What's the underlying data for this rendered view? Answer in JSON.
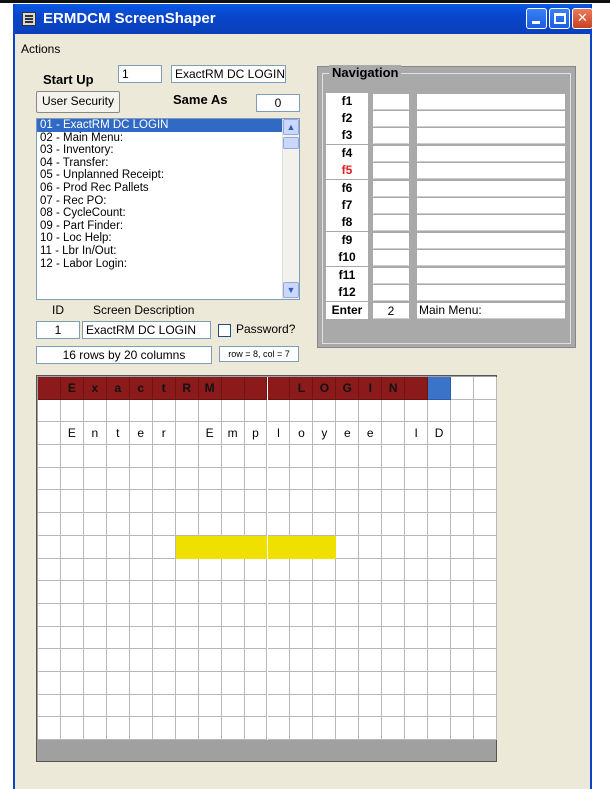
{
  "window": {
    "title": "ERMDCM ScreenShaper"
  },
  "menu": {
    "actions": "Actions"
  },
  "startup": {
    "label": "Start Up",
    "id_value": "1",
    "name_value": "ExactRM DC  LOGIN",
    "user_security": "User Security",
    "same_as_label": "Same As",
    "same_as_value": "0"
  },
  "screens": [
    "01 - ExactRM DC  LOGIN",
    "02 - Main Menu:",
    "03 - Inventory:",
    "04 - Transfer:",
    "05 - Unplanned Receipt:",
    "06 - Prod Rec Pallets",
    "07 - Rec PO:",
    "08 - CycleCount:",
    "09 - Part Finder:",
    "10 - Loc Help:",
    "11 - Lbr In/Out:",
    "12 - Labor Login:"
  ],
  "detail": {
    "id_label": "ID",
    "desc_label": "Screen Description",
    "id_value": "1",
    "desc_value": "ExactRM DC  LOGIN",
    "password_label": "Password?",
    "size_text": "16 rows by 20 columns",
    "cursor_text": "row = 8, col = 7"
  },
  "navigation": {
    "title": "Navigation",
    "rows": [
      {
        "key": "f1",
        "num": "",
        "desc": ""
      },
      {
        "key": "f2",
        "num": "",
        "desc": ""
      },
      {
        "key": "f3",
        "num": "",
        "desc": ""
      },
      {
        "key": "f4",
        "num": "",
        "desc": ""
      },
      {
        "key": "f5",
        "num": "",
        "desc": "",
        "red": true
      },
      {
        "key": "f6",
        "num": "",
        "desc": ""
      },
      {
        "key": "f7",
        "num": "",
        "desc": ""
      },
      {
        "key": "f8",
        "num": "",
        "desc": ""
      },
      {
        "key": "f9",
        "num": "",
        "desc": ""
      },
      {
        "key": "f10",
        "num": "",
        "desc": ""
      },
      {
        "key": "f11",
        "num": "",
        "desc": ""
      },
      {
        "key": "f12",
        "num": "",
        "desc": ""
      },
      {
        "key": "Enter",
        "num": "2",
        "desc": "Main Menu:"
      }
    ]
  },
  "grid": {
    "rows": 16,
    "cols": 20,
    "header_row": [
      "",
      "E",
      "x",
      "a",
      "c",
      "t",
      "R",
      "M",
      "",
      "",
      "",
      "L",
      "O",
      "G",
      "I",
      "N",
      "",
      "",
      "",
      ""
    ],
    "header_filled_to": 17,
    "cursor_col": 18,
    "text_rows": {
      "2": [
        "",
        "E",
        "n",
        "t",
        "e",
        "r",
        "",
        "E",
        "m",
        "p",
        "l",
        "o",
        "y",
        "e",
        "e",
        "",
        "I",
        "D",
        "",
        ""
      ]
    },
    "highlight": {
      "row": 8,
      "col_start": 6,
      "col_end": 12
    }
  }
}
